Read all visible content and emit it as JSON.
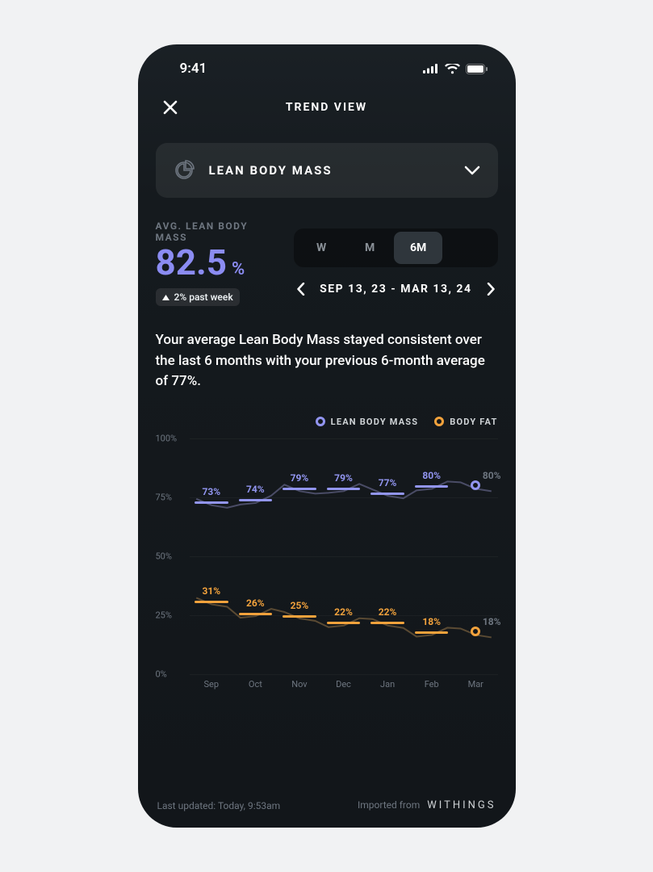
{
  "statusbar": {
    "time": "9:41"
  },
  "header": {
    "title": "TREND VIEW"
  },
  "selector": {
    "label": "LEAN BODY MASS"
  },
  "stat": {
    "caption": "AVG. LEAN BODY MASS",
    "value": "82.5",
    "unit": "%",
    "delta": "2% past week"
  },
  "segments": {
    "items": [
      "W",
      "M",
      "6M"
    ],
    "active": 2
  },
  "date_range": "SEP 13, 23  -  MAR 13, 24",
  "summary": "Your average Lean Body Mass stayed consistent over the last 6 months with your previous 6-month average of 77%.",
  "legend": [
    {
      "name": "LEAN BODY MASS",
      "color": "#9295f0"
    },
    {
      "name": "BODY FAT",
      "color": "#f2a23c"
    }
  ],
  "chart_data": {
    "type": "line",
    "categories": [
      "Sep",
      "Oct",
      "Nov",
      "Dec",
      "Jan",
      "Feb",
      "Mar"
    ],
    "ylim": [
      0,
      100
    ],
    "yticks": [
      "0%",
      "25%",
      "50%",
      "75%",
      "100%"
    ],
    "series": [
      {
        "name": "LEAN BODY MASS",
        "color": "#9295f0",
        "values": [
          73,
          74,
          79,
          79,
          77,
          80,
          80
        ],
        "labels": [
          "73%",
          "74%",
          "79%",
          "79%",
          "77%",
          "80%",
          "80%"
        ]
      },
      {
        "name": "BODY FAT",
        "color": "#f2a23c",
        "values": [
          31,
          26,
          25,
          22,
          22,
          18,
          18
        ],
        "labels": [
          "31%",
          "26%",
          "25%",
          "22%",
          "22%",
          "18%",
          "18%"
        ]
      }
    ]
  },
  "footer": {
    "updated": "Last updated: Today, 9:53am",
    "source_prefix": "Imported from",
    "source": "WITHINGS"
  }
}
